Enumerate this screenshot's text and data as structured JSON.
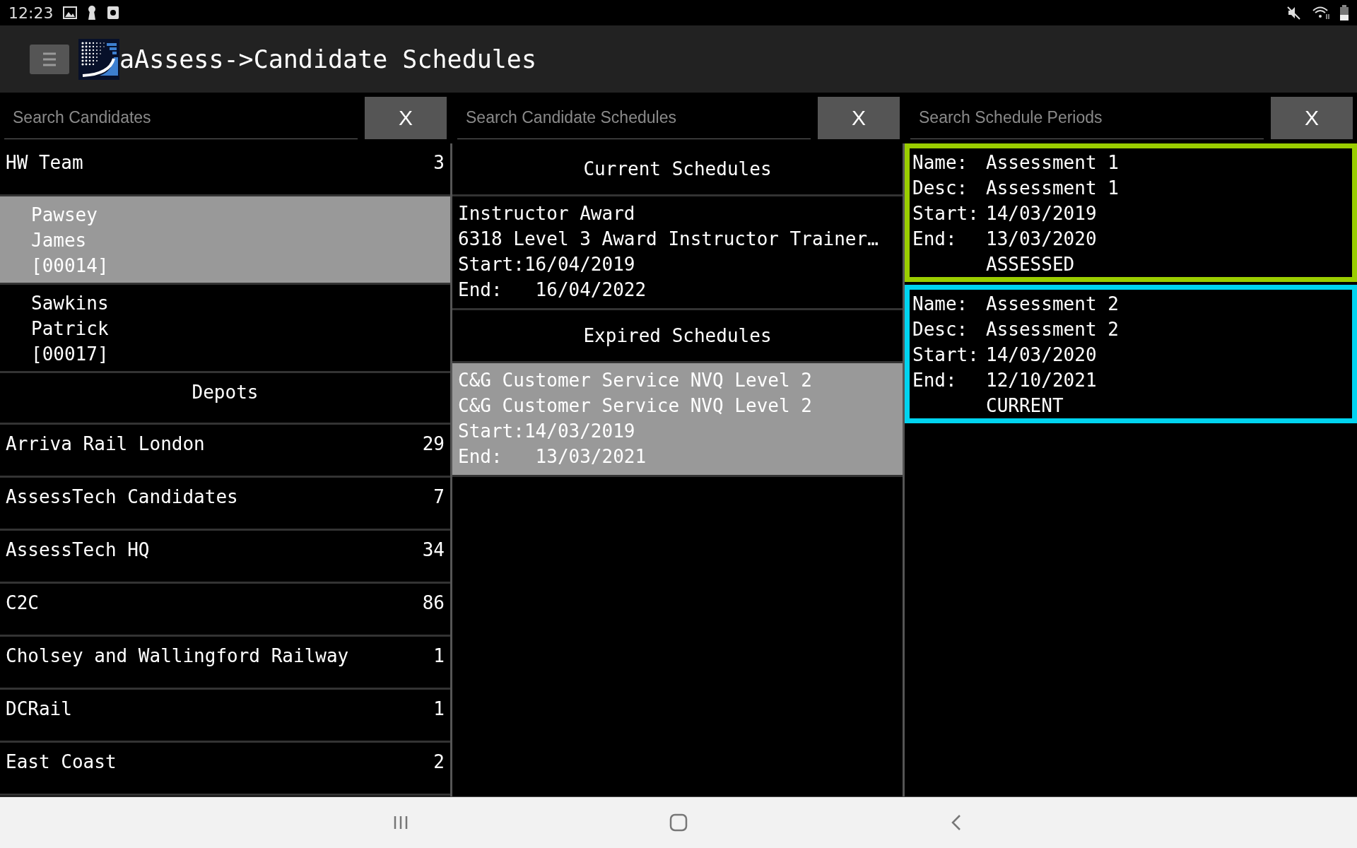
{
  "status_bar": {
    "time": "12:23"
  },
  "header": {
    "title": "aAssess->Candidate Schedules"
  },
  "searches": [
    {
      "placeholder": "Search Candidates",
      "clear": "X"
    },
    {
      "placeholder": "Search Candidate Schedules",
      "clear": "X"
    },
    {
      "placeholder": "Search Schedule Periods",
      "clear": "X"
    }
  ],
  "candidates": [
    {
      "kind": "group",
      "label": "HW Team",
      "count": "3"
    },
    {
      "kind": "candidate",
      "lines": [
        "Pawsey",
        "James",
        "[00014]"
      ],
      "selected": true
    },
    {
      "kind": "candidate",
      "lines": [
        "Sawkins",
        "Patrick",
        "[00017]"
      ],
      "selected": false
    },
    {
      "kind": "heading",
      "label": "Depots"
    },
    {
      "kind": "group",
      "label": "Arriva Rail London",
      "count": "29"
    },
    {
      "kind": "group",
      "label": "AssessTech Candidates",
      "count": "7"
    },
    {
      "kind": "group",
      "label": "AssessTech HQ",
      "count": "34"
    },
    {
      "kind": "group",
      "label": "C2C",
      "count": "86"
    },
    {
      "kind": "group",
      "label": "Cholsey and Wallingford Railway",
      "count": "1"
    },
    {
      "kind": "group",
      "label": "DCRail",
      "count": "1"
    },
    {
      "kind": "group",
      "label": "East Coast",
      "count": "2"
    }
  ],
  "schedules": [
    {
      "kind": "heading",
      "label": "Current Schedules"
    },
    {
      "kind": "schedule",
      "lines": [
        "Instructor Award",
        "6318 Level 3 Award Instructor Trainer…",
        "Start:16/04/2019",
        "End:   16/04/2022"
      ],
      "selected": false
    },
    {
      "kind": "heading",
      "label": "Expired Schedules"
    },
    {
      "kind": "schedule",
      "lines": [
        "C&G Customer Service NVQ Level 2",
        "C&G Customer Service NVQ Level 2",
        "Start:14/03/2019",
        "End:   13/03/2021"
      ],
      "selected": true
    }
  ],
  "periods": [
    {
      "color": "#9acd00",
      "fields": [
        {
          "label": "Name:",
          "value": "Assessment 1"
        },
        {
          "label": "Desc:",
          "value": "Assessment 1"
        },
        {
          "label": "Start:",
          "value": "14/03/2019"
        },
        {
          "label": "End:",
          "value": "13/03/2020"
        }
      ],
      "status": "ASSESSED"
    },
    {
      "color": "#00d4f0",
      "fields": [
        {
          "label": "Name:",
          "value": "Assessment 2"
        },
        {
          "label": "Desc:",
          "value": "Assessment 2"
        },
        {
          "label": "Start:",
          "value": "14/03/2020"
        },
        {
          "label": "End:",
          "value": "12/10/2021"
        }
      ],
      "status": "CURRENT"
    }
  ]
}
